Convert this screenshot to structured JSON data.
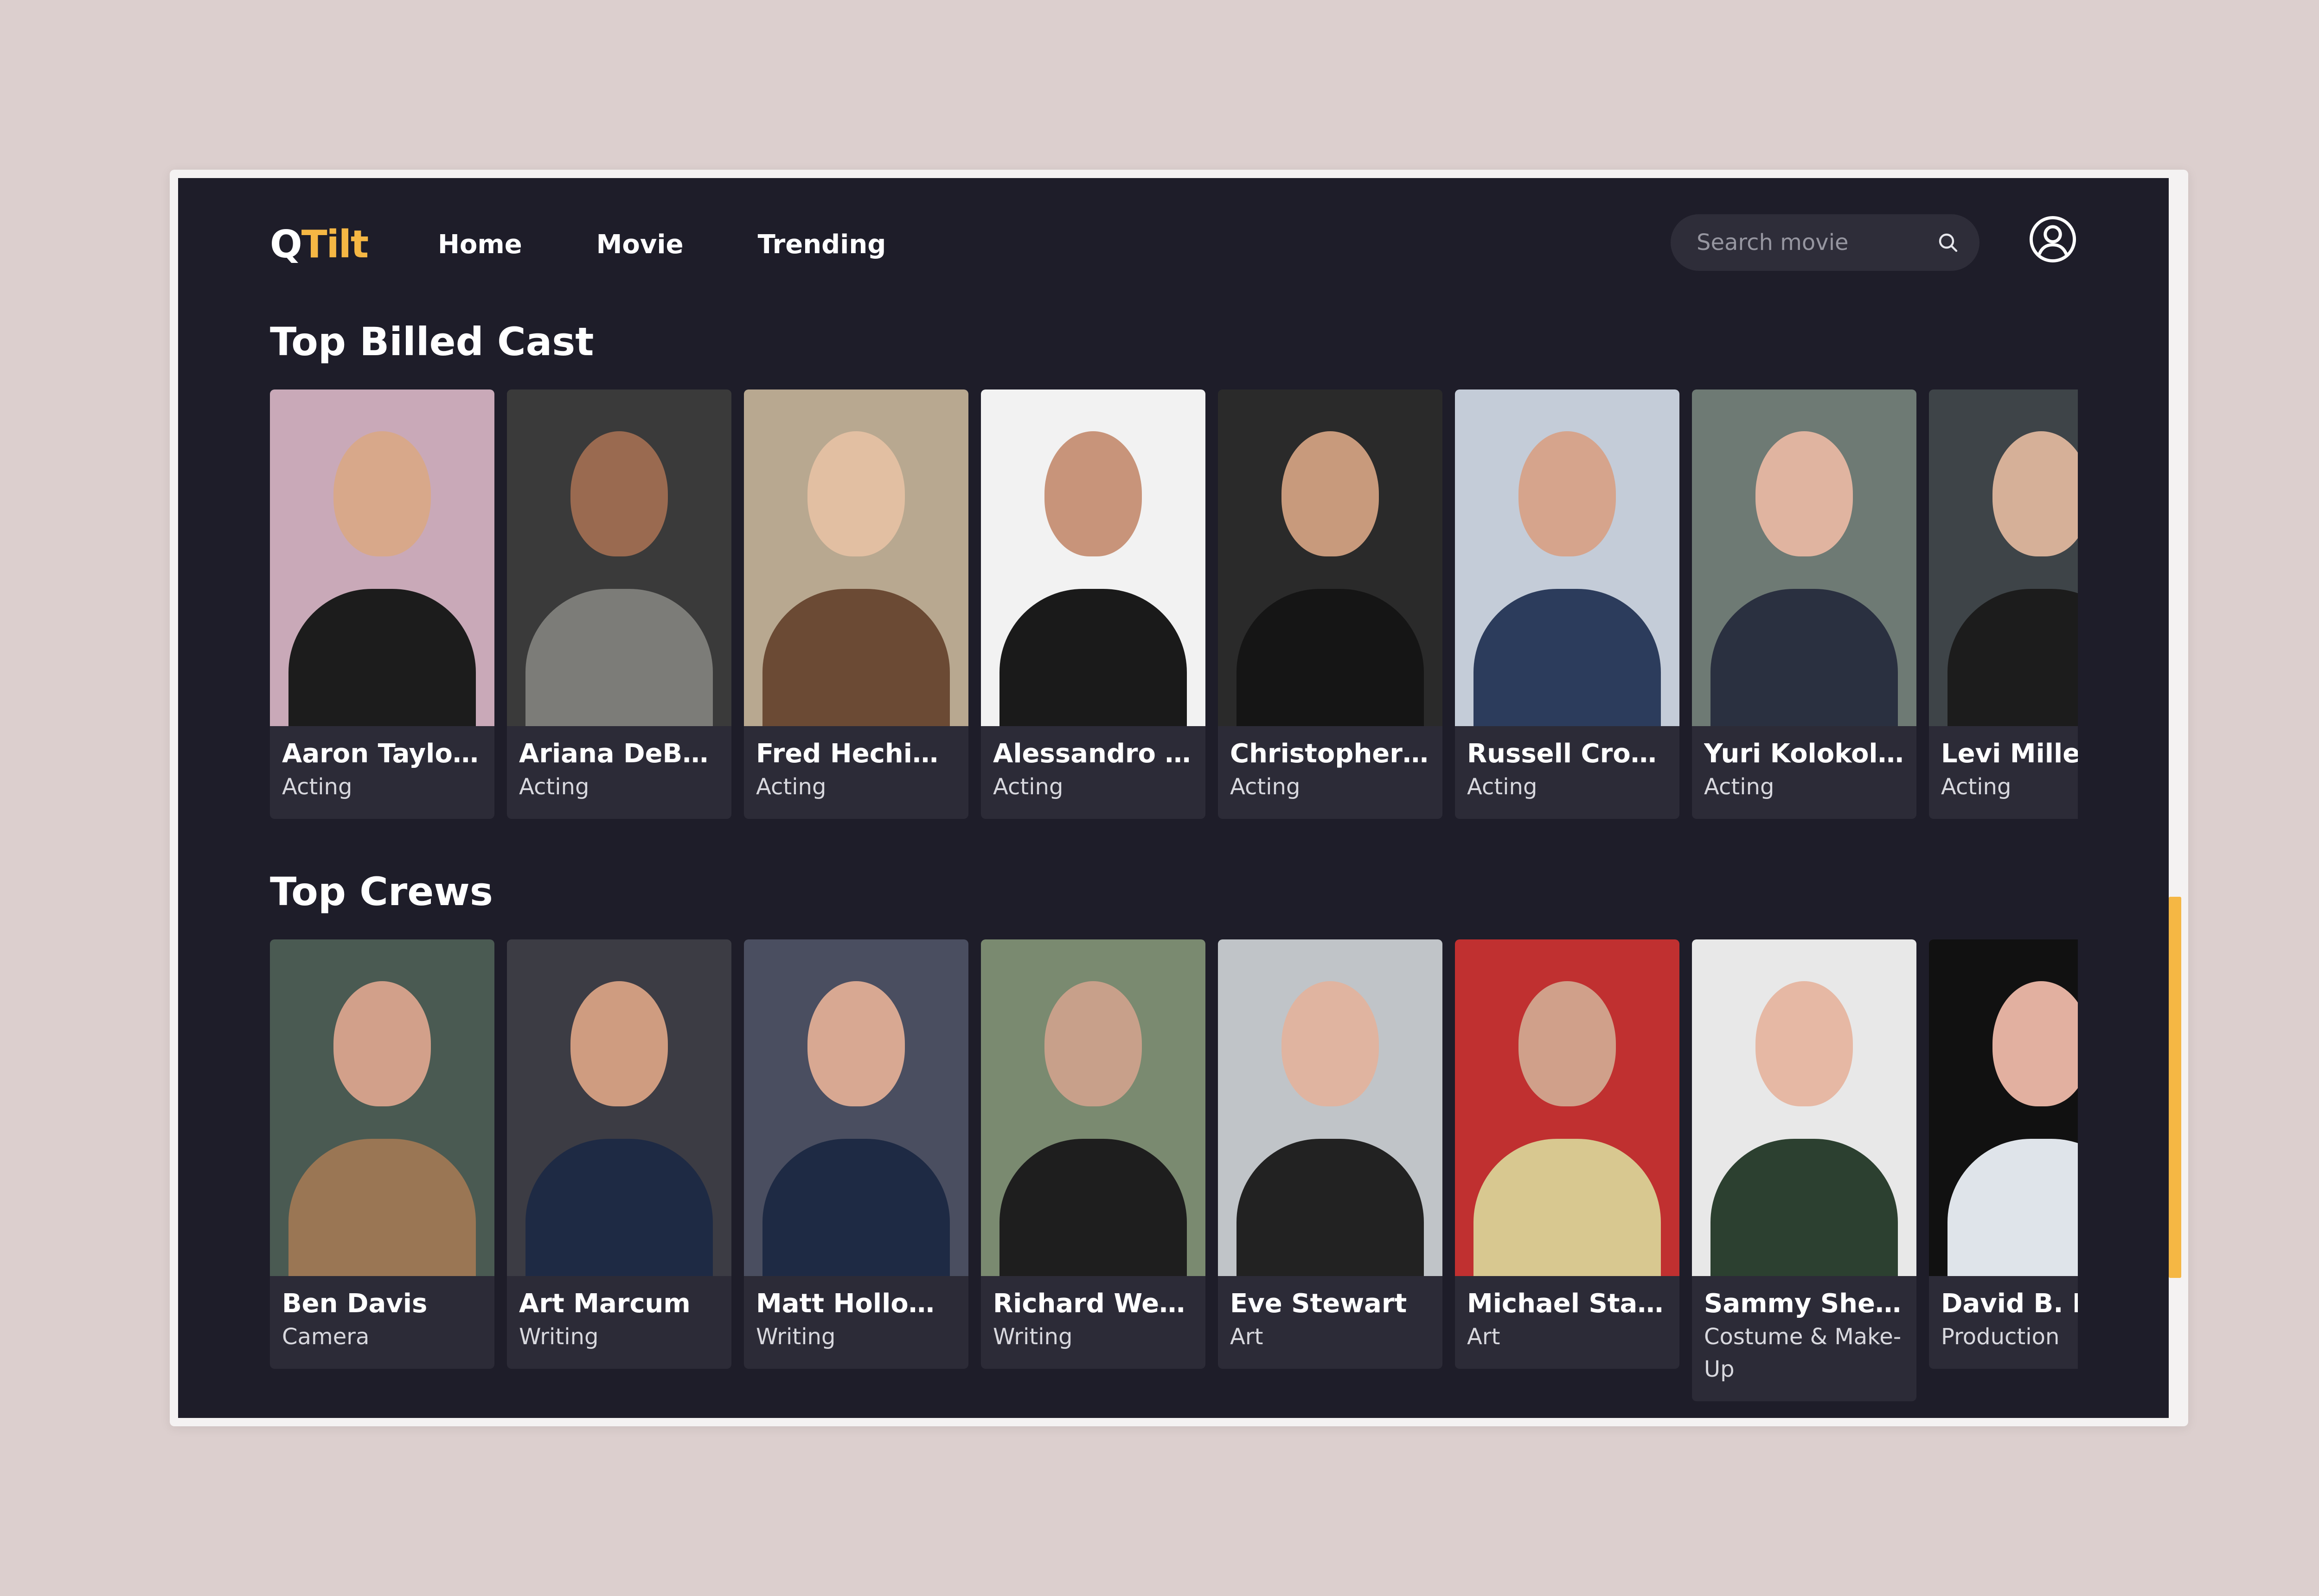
{
  "app": {
    "logo": {
      "first": "Q",
      "rest": "Tilt"
    },
    "nav": [
      "Home",
      "Movie",
      "Trending"
    ],
    "search": {
      "placeholder": "Search movie",
      "value": ""
    },
    "accent_color": "#f5b744",
    "background_color": "#1e1d29",
    "card_color": "#2c2b37"
  },
  "cast": {
    "title": "Top Billed Cast",
    "items": [
      {
        "name": "Aaron Taylor-...",
        "role": "Acting",
        "bg": "#c9a9b8",
        "skin": "#d8a88a",
        "cloth": "#1c1c1c"
      },
      {
        "name": "Ariana DeBose",
        "role": "Acting",
        "bg": "#3a3a3a",
        "skin": "#9a6a50",
        "cloth": "#7c7c78"
      },
      {
        "name": "Fred Hechinger",
        "role": "Acting",
        "bg": "#b8a890",
        "skin": "#e2bfa2",
        "cloth": "#6b4a34"
      },
      {
        "name": "Alessandro Ni...",
        "role": "Acting",
        "bg": "#f2f2f2",
        "skin": "#c8947a",
        "cloth": "#1a1a1a"
      },
      {
        "name": "Christopher A...",
        "role": "Acting",
        "bg": "#2a2a2a",
        "skin": "#c89a7c",
        "cloth": "#151515"
      },
      {
        "name": "Russell Crowe",
        "role": "Acting",
        "bg": "#c4ccd8",
        "skin": "#d6a48c",
        "cloth": "#2c3c5c"
      },
      {
        "name": "Yuri Kolokolnik...",
        "role": "Acting",
        "bg": "#6e7a74",
        "skin": "#e0b4a0",
        "cloth": "#2a3040"
      },
      {
        "name": "Levi Miller",
        "role": "Acting",
        "bg": "#3e4448",
        "skin": "#d6b098",
        "cloth": "#1c1c1c"
      }
    ]
  },
  "crew": {
    "title": "Top Crews",
    "items": [
      {
        "name": "Ben Davis",
        "role": "Camera",
        "bg": "#4a5a52",
        "skin": "#d2a08a",
        "cloth": "#9a7654"
      },
      {
        "name": "Art Marcum",
        "role": "Writing",
        "bg": "#3c3c44",
        "skin": "#cf9c80",
        "cloth": "#1e2a44"
      },
      {
        "name": "Matt Holloway",
        "role": "Writing",
        "bg": "#4a4e60",
        "skin": "#d8a892",
        "cloth": "#1e2a44"
      },
      {
        "name": "Richard Wenk",
        "role": "Writing",
        "bg": "#7a8a70",
        "skin": "#c8a08a",
        "cloth": "#1e1e1e"
      },
      {
        "name": "Eve Stewart",
        "role": "Art",
        "bg": "#c0c4c8",
        "skin": "#e0b4a0",
        "cloth": "#222222"
      },
      {
        "name": "Michael Stand...",
        "role": "Art",
        "bg": "#c03030",
        "skin": "#d0a08a",
        "cloth": "#d8c890"
      },
      {
        "name": "Sammy Sheld...",
        "role": "Costume & Make-Up",
        "bg": "#e8e8e8",
        "skin": "#e6b8a4",
        "cloth": "#2c4030"
      },
      {
        "name": "David B. Ho",
        "role": "Production",
        "bg": "#111111",
        "skin": "#e2b0a0",
        "cloth": "#dfe4ea"
      }
    ]
  }
}
